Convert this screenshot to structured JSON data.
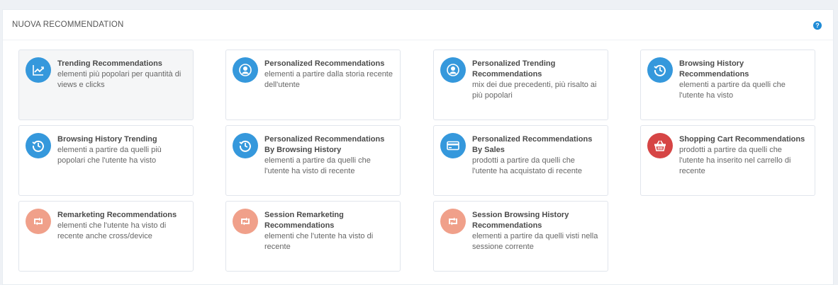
{
  "panel": {
    "title": "NUOVA RECOMMENDATION",
    "help_icon": "question-circle-icon",
    "help_label": "?"
  },
  "colors": {
    "blue": "#3598dc",
    "red": "#d64545",
    "salmon": "#f0a08a"
  },
  "cards": [
    {
      "title": "Trending Recommendations",
      "desc": "elementi più popolari per quantità di views e clicks",
      "icon": "trending-chart-icon",
      "color": "blue"
    },
    {
      "title": "Personalized Recommendations",
      "desc": "elementi a partire dalla storia recente dell'utente",
      "icon": "user-icon",
      "color": "blue"
    },
    {
      "title": "Personalized Trending Recommendations",
      "desc": "mix dei due precedenti, più risalto ai più popolari",
      "icon": "user-icon",
      "color": "blue"
    },
    {
      "title": "Browsing History Recommendations",
      "desc": "elementi a partire da quelli che l'utente ha visto",
      "icon": "history-icon",
      "color": "blue"
    },
    {
      "title": "Browsing History Trending",
      "desc": "elementi a partire da quelli più popolari che l'utente ha visto",
      "icon": "history-icon",
      "color": "blue"
    },
    {
      "title": "Personalized Recommendations By Browsing History",
      "desc": "elementi a partire da quelli che l'utente ha visto di recente",
      "icon": "history-icon",
      "color": "blue"
    },
    {
      "title": "Personalized Recommendations By Sales",
      "desc": "prodotti a partire da quelli che l'utente ha acquistato di recente",
      "icon": "credit-card-icon",
      "color": "blue"
    },
    {
      "title": "Shopping Cart Recommendations",
      "desc": "prodotti a partire da quelli che l'utente ha inserito nel carrello di recente",
      "icon": "shopping-basket-icon",
      "color": "red"
    },
    {
      "title": "Remarketing Recommendations",
      "desc": "elementi che l'utente ha visto di recente anche cross/device",
      "icon": "retweet-icon",
      "color": "salmon"
    },
    {
      "title": "Session Remarketing Recommendations",
      "desc": "elementi che l'utente ha visto di recente",
      "icon": "retweet-icon",
      "color": "salmon"
    },
    {
      "title": "Session Browsing History Recommendations",
      "desc": "elementi a partire da quelli visti nella sessione corrente",
      "icon": "retweet-icon",
      "color": "salmon"
    }
  ]
}
